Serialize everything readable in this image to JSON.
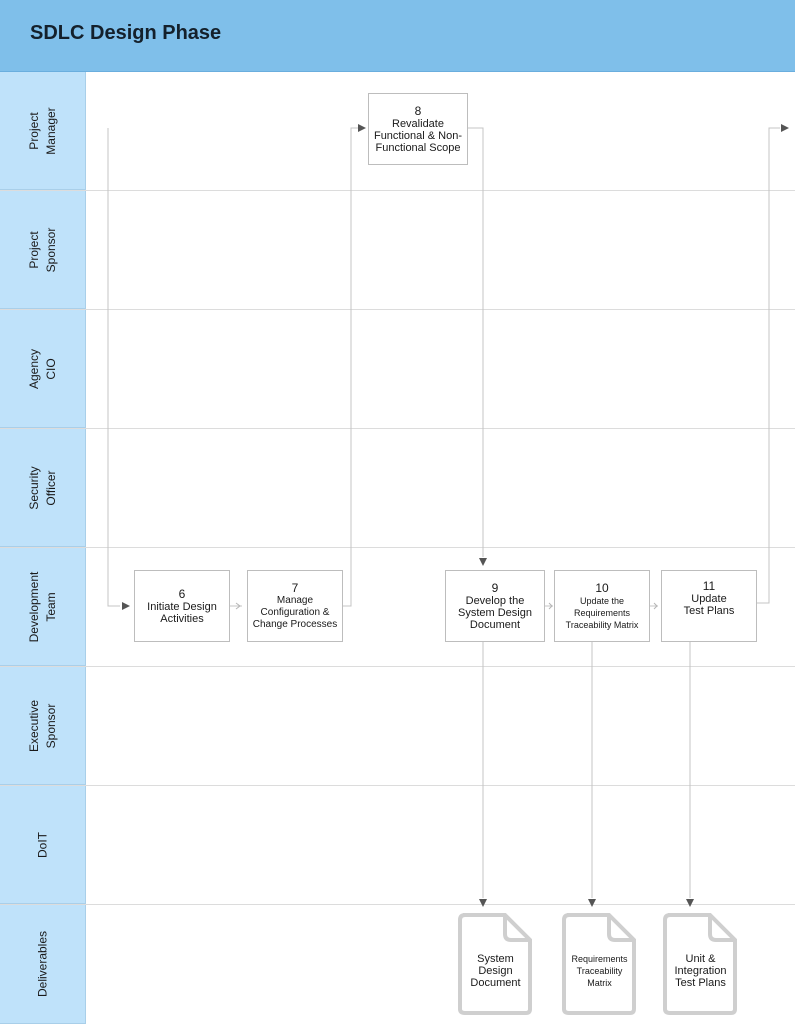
{
  "header": {
    "title": "SDLC Design Phase"
  },
  "lanes": [
    {
      "label": "Project\nManager"
    },
    {
      "label": "Project\nSponsor"
    },
    {
      "label": "Agency\nCIO"
    },
    {
      "label": "Security\nOfficer"
    },
    {
      "label": "Development\nTeam"
    },
    {
      "label": "Executive\nSponsor"
    },
    {
      "label": "DoIT"
    },
    {
      "label": "Deliverables"
    }
  ],
  "steps": [
    {
      "num": "6",
      "label": "Initiate Design\nActivities",
      "lane": "Development Team"
    },
    {
      "num": "7",
      "label": "Manage\nConfiguration &\nChange Processes",
      "lane": "Development Team"
    },
    {
      "num": "8",
      "label": "Revalidate\nFunctional & Non-\nFunctional Scope",
      "lane": "Project Manager"
    },
    {
      "num": "9",
      "label": "Develop the\nSystem Design\nDocument",
      "lane": "Development Team"
    },
    {
      "num": "10",
      "label": "Update the\nRequirements\nTraceability Matrix",
      "lane": "Development Team"
    },
    {
      "num": "11",
      "label": "Update\nTest Plans",
      "lane": "Development Team"
    }
  ],
  "deliverables": [
    {
      "label": "System\nDesign\nDocument"
    },
    {
      "label": "Requirements\nTraceability\nMatrix"
    },
    {
      "label": "Unit &\nIntegration\nTest Plans"
    }
  ],
  "colors": {
    "header": "#7fbfea",
    "lane_label": "#bfe2fa",
    "connector": "#bdbdbd",
    "arrow": "#555555"
  }
}
